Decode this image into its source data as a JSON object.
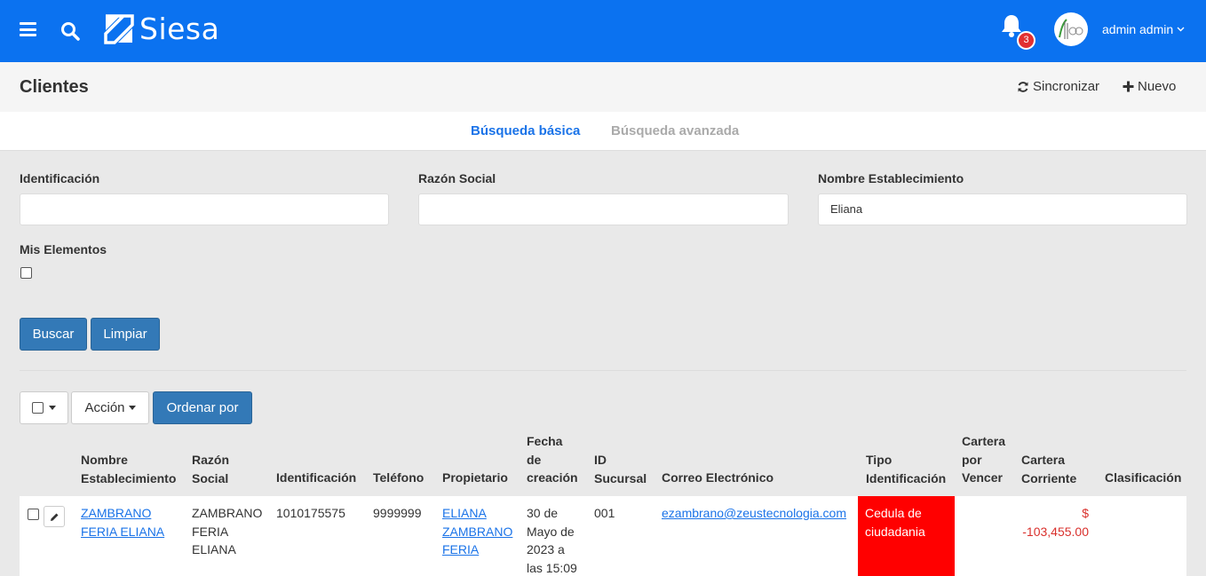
{
  "topbar": {
    "brand": "Siesa",
    "notification_count": "3",
    "user_name": "admin admin",
    "bg_color": "#0b72f0"
  },
  "page": {
    "title": "Clientes",
    "sync_label": "Sincronizar",
    "new_label": "Nuevo"
  },
  "tabs": {
    "basic": "Búsqueda básica",
    "advanced": "Búsqueda avanzada"
  },
  "form": {
    "id_label": "Identificación",
    "id_value": "",
    "razon_label": "Razón Social",
    "razon_value": "",
    "nombre_label": "Nombre Establecimiento",
    "nombre_value": "Eliana",
    "mis_label": "Mis Elementos",
    "search_btn": "Buscar",
    "clear_btn": "Limpiar"
  },
  "toolbar": {
    "action_label": "Acción",
    "order_label": "Ordenar por"
  },
  "table": {
    "headers": {
      "nombre": [
        "Nombre",
        "Establecimiento"
      ],
      "razon": [
        "Razón",
        "Social"
      ],
      "id": "Identificación",
      "tel": "Teléfono",
      "prop": "Propietario",
      "fecha": [
        "Fecha",
        "de",
        "creación"
      ],
      "sucursal": [
        "ID",
        "Sucursal"
      ],
      "correo": "Correo Electrónico",
      "tipo": [
        "Tipo",
        "Identificación"
      ],
      "cartera_vencer": [
        "Cartera",
        "por",
        "Vencer"
      ],
      "cartera_corriente": [
        "Cartera",
        "Corriente"
      ],
      "clasificacion": "Clasificación"
    },
    "rows": [
      {
        "nombre": [
          "ZAMBRANO",
          "FERIA ELIANA"
        ],
        "razon": [
          "ZAMBRANO",
          "FERIA",
          "ELIANA"
        ],
        "id": "1010175575",
        "tel": "9999999",
        "prop": [
          "ELIANA",
          "ZAMBRANO",
          "FERIA"
        ],
        "fecha": [
          "30 de",
          "Mayo de",
          "2023 a",
          "las 15:09"
        ],
        "sucursal": "001",
        "correo": "ezambrano@zeustecnologia.com",
        "tipo": [
          "Cedula de",
          "ciudadania"
        ],
        "cartera_corriente": [
          "$",
          "-103,455.00"
        ]
      }
    ]
  }
}
